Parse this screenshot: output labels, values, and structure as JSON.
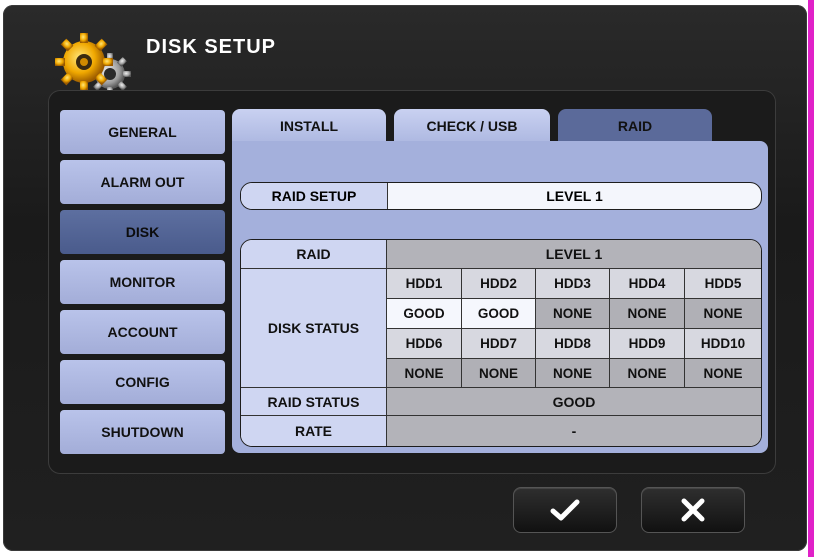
{
  "header": {
    "title": "DISK SETUP",
    "icon": "gear-icon"
  },
  "sidebar": {
    "items": [
      {
        "label": "GENERAL"
      },
      {
        "label": "ALARM OUT"
      },
      {
        "label": "DISK",
        "active": true
      },
      {
        "label": "MONITOR"
      },
      {
        "label": "ACCOUNT"
      },
      {
        "label": "CONFIG"
      },
      {
        "label": "SHUTDOWN"
      }
    ]
  },
  "tabs": [
    {
      "label": "INSTALL"
    },
    {
      "label": "CHECK / USB"
    },
    {
      "label": "RAID",
      "active": true
    }
  ],
  "raid_setup": {
    "label": "RAID SETUP",
    "value": "LEVEL 1"
  },
  "table": {
    "raid_label": "RAID",
    "raid_value": "LEVEL 1",
    "disk_status_label": "DISK STATUS",
    "disks_row1": [
      {
        "name": "HDD1",
        "status": "GOOD"
      },
      {
        "name": "HDD2",
        "status": "GOOD"
      },
      {
        "name": "HDD3",
        "status": "NONE"
      },
      {
        "name": "HDD4",
        "status": "NONE"
      },
      {
        "name": "HDD5",
        "status": "NONE"
      }
    ],
    "disks_row2": [
      {
        "name": "HDD6",
        "status": "NONE"
      },
      {
        "name": "HDD7",
        "status": "NONE"
      },
      {
        "name": "HDD8",
        "status": "NONE"
      },
      {
        "name": "HDD9",
        "status": "NONE"
      },
      {
        "name": "HDD10",
        "status": "NONE"
      }
    ],
    "raid_status_label": "RAID STATUS",
    "raid_status_value": "GOOD",
    "rate_label": "RATE",
    "rate_value": "-"
  },
  "buttons": {
    "confirm_icon": "checkmark-icon",
    "cancel_icon": "close-icon"
  },
  "colors": {
    "accent": "#e021c8",
    "sidebar_active": "#5b6a9a",
    "content_bg": "#a4b0dc",
    "status_good": "#f5f7fd",
    "status_none": "#b0b0b6"
  }
}
